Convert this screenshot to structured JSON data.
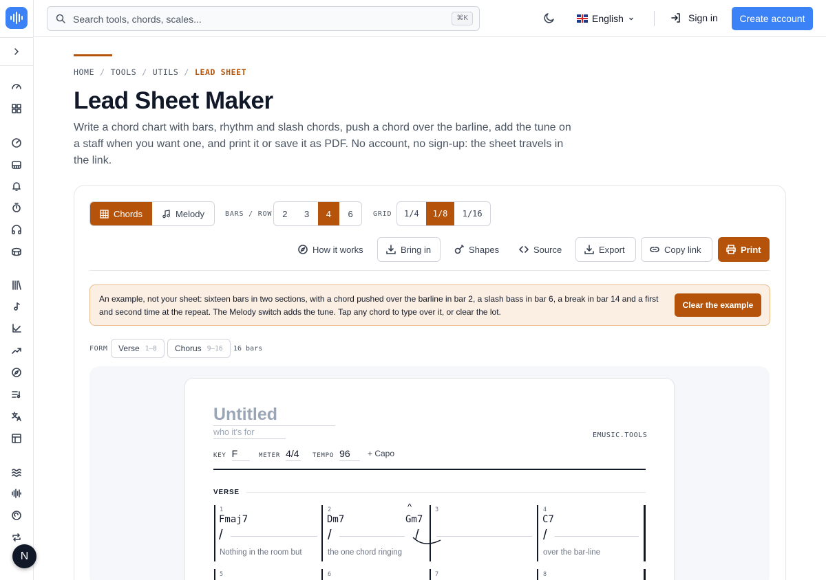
{
  "header": {
    "search_placeholder": "Search tools, chords, scales...",
    "search_shortcut": "⌘K",
    "language": "English",
    "sign_in": "Sign in",
    "create_account": "Create account"
  },
  "sidebar": {
    "avatar_letter": "N",
    "items": [
      "dashboard-icon",
      "grid-icon",
      "target-icon",
      "piano-icon",
      "bell-icon",
      "timer-icon",
      "headphones-icon",
      "drum-icon",
      "library-icon",
      "music-note-icon",
      "chart-axes-icon",
      "trend-icon",
      "compass-icon",
      "list-music-icon",
      "translate-icon",
      "table-icon",
      "waves-icon",
      "waveform-icon",
      "ear-icon",
      "repeat-icon"
    ]
  },
  "breadcrumb": [
    "HOME",
    "TOOLS",
    "UTILS",
    "LEAD SHEET"
  ],
  "page": {
    "title": "Lead Sheet Maker",
    "intro": "Write a chord chart with bars, rhythm and slash chords, push a chord over the barline, add the tune on a staff when you want one, and print it or save it as PDF. No account, no sign-up: the sheet travels in the link."
  },
  "controls": {
    "modes": [
      "Chords",
      "Melody"
    ],
    "active_mode": "Chords",
    "bars_label": "BARS / ROW",
    "bars_options": [
      "2",
      "3",
      "4",
      "6"
    ],
    "bars_selected": "4",
    "grid_label": "GRID",
    "grid_options": [
      "1/4",
      "1/8",
      "1/16"
    ],
    "grid_selected": "1/8"
  },
  "toolbar": {
    "how_it_works": "How it works",
    "bring_in": "Bring in",
    "shapes": "Shapes",
    "source": "Source",
    "export": "Export",
    "copy_link": "Copy link",
    "print": "Print"
  },
  "notice": {
    "text": "An example, not your sheet: sixteen bars in two sections, with a chord pushed over the barline in bar 2, a slash bass in bar 6, a break in bar 14 and a first and second time at the repeat. The Melody switch adds the tune. Tap any chord to type over it, or clear the lot.",
    "button": "Clear the example"
  },
  "form": {
    "label": "FORM",
    "sections": [
      {
        "name": "Verse",
        "range": "1–8"
      },
      {
        "name": "Chorus",
        "range": "9–16"
      }
    ],
    "count": "16 bars"
  },
  "sheet": {
    "title_placeholder": "Untitled",
    "subtitle_placeholder": "who it's for",
    "brand": "EMUSIC.TOOLS",
    "key_label": "KEY",
    "key": "F",
    "meter_label": "METER",
    "meter": "4/4",
    "tempo_label": "TEMPO",
    "tempo": "96",
    "capo": "+ Capo",
    "section_name": "VERSE",
    "bars": [
      {
        "num": "1",
        "chord": "Fmaj7",
        "slash": "/",
        "lyric": "Nothing in the room but"
      },
      {
        "num": "2",
        "chord": "Dm7",
        "pushed_chord": "Gm7",
        "push_mark": "^",
        "slash": "/",
        "lyric": "the one chord ringing"
      },
      {
        "num": "3",
        "chord": "",
        "slash": "/",
        "lyric": ""
      },
      {
        "num": "4",
        "chord": "C7",
        "slash": "/",
        "lyric": "over the bar-line"
      }
    ],
    "next_row_nums": [
      "5",
      "6",
      "7",
      "8"
    ]
  },
  "colors": {
    "accent": "#b45309",
    "brand_blue": "#3b82f6",
    "notice_bg": "#fbeee2"
  }
}
